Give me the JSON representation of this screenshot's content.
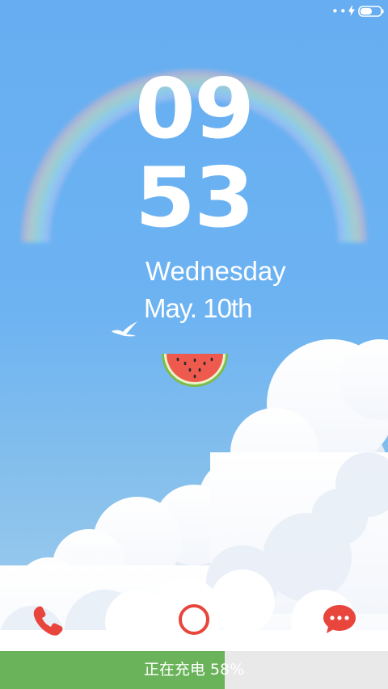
{
  "status_bar": {
    "dots": "•••",
    "charging_icon": "lightning-bolt-icon",
    "battery_icon": "battery-icon",
    "battery_level": 0.58
  },
  "clock": {
    "hours": "09",
    "minutes": "53"
  },
  "date": {
    "weekday": "Wednesday",
    "date": "May. 10th"
  },
  "wallpaper": {
    "elements": [
      "rainbow",
      "seagull",
      "watermelon-slice",
      "clouds"
    ]
  },
  "dock": {
    "phone_icon": "phone-icon",
    "unlock_icon": "ring-icon",
    "message_icon": "message-icon",
    "accent_color": "#e8453c"
  },
  "charging": {
    "label": "正在充电",
    "percent": "58%",
    "level": 0.58,
    "fill_color": "#6ab35a"
  }
}
